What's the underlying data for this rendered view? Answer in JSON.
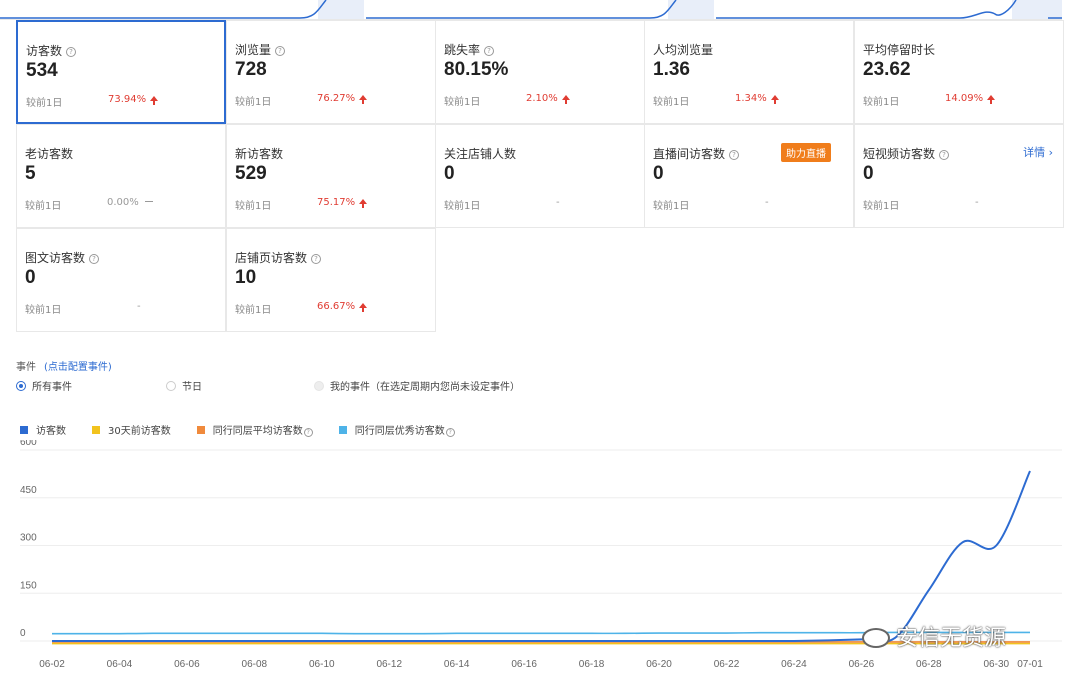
{
  "metrics": [
    {
      "label": "访客数",
      "help": true,
      "value": "534",
      "cmp": "较前1日",
      "pct": "73.94%",
      "trend": "up",
      "selected": true
    },
    {
      "label": "浏览量",
      "help": true,
      "value": "728",
      "cmp": "较前1日",
      "pct": "76.27%",
      "trend": "up"
    },
    {
      "label": "跳失率",
      "help": true,
      "value": "80.15%",
      "cmp": "较前1日",
      "pct": "2.10%",
      "trend": "up"
    },
    {
      "label": "人均浏览量",
      "help": false,
      "value": "1.36",
      "cmp": "较前1日",
      "pct": "1.34%",
      "trend": "up"
    },
    {
      "label": "平均停留时长",
      "help": false,
      "value": "23.62",
      "cmp": "较前1日",
      "pct": "14.09%",
      "trend": "up"
    },
    {
      "label": "老访客数",
      "help": false,
      "value": "5",
      "cmp": "较前1日",
      "pct": "0.00%",
      "trend": "flat"
    },
    {
      "label": "新访客数",
      "help": false,
      "value": "529",
      "cmp": "较前1日",
      "pct": "75.17%",
      "trend": "up"
    },
    {
      "label": "关注店铺人数",
      "help": false,
      "value": "0",
      "cmp": "较前1日",
      "pct": "-",
      "trend": "none"
    },
    {
      "label": "直播间访客数",
      "help": true,
      "value": "0",
      "cmp": "较前1日",
      "pct": "-",
      "trend": "none",
      "badge": "助力直播"
    },
    {
      "label": "短视频访客数",
      "help": true,
      "value": "0",
      "cmp": "较前1日",
      "pct": "-",
      "trend": "none",
      "detail": "详情 ›"
    },
    {
      "label": "图文访客数",
      "help": true,
      "value": "0",
      "cmp": "较前1日",
      "pct": "-",
      "trend": "none"
    },
    {
      "label": "店铺页访客数",
      "help": true,
      "value": "10",
      "cmp": "较前1日",
      "pct": "66.67%",
      "trend": "up"
    }
  ],
  "events": {
    "title": "事件",
    "config_link": "(点击配置事件)",
    "options": [
      "所有事件",
      "节日",
      "我的事件（在选定周期内您尚未设定事件）"
    ]
  },
  "watermark": "安信无货源",
  "colors": {
    "primary": "#2d6bd1",
    "up": "#e03c32",
    "badge": "#f07d1b"
  },
  "chart_data": {
    "type": "line",
    "x": [
      "06-02",
      "06-03",
      "06-04",
      "06-05",
      "06-06",
      "06-07",
      "06-08",
      "06-09",
      "06-10",
      "06-11",
      "06-12",
      "06-13",
      "06-14",
      "06-15",
      "06-16",
      "06-17",
      "06-18",
      "06-19",
      "06-20",
      "06-21",
      "06-22",
      "06-23",
      "06-24",
      "06-25",
      "06-26",
      "06-27",
      "06-28",
      "06-29",
      "06-30",
      "07-01"
    ],
    "tick_labels": [
      "06-02",
      "06-04",
      "06-06",
      "06-08",
      "06-10",
      "06-12",
      "06-14",
      "06-16",
      "06-18",
      "06-20",
      "06-22",
      "06-24",
      "06-26",
      "06-28",
      "06-30",
      "07-01"
    ],
    "y_ticks": [
      "600",
      "450",
      "300",
      "150",
      "0"
    ],
    "ylim": [
      0,
      600
    ],
    "grid": true,
    "legend_position": "top-left",
    "series": [
      {
        "name": "访客数",
        "color": "#2d6bd1",
        "values": [
          0,
          0,
          0,
          0,
          0,
          0,
          0,
          0,
          0,
          0,
          0,
          0,
          0,
          0,
          0,
          0,
          0,
          0,
          0,
          0,
          0,
          0,
          0,
          2,
          5,
          10,
          160,
          310,
          300,
          534
        ]
      },
      {
        "name": "30天前访客数",
        "color": "#f2c31d",
        "values": [
          -8,
          -8,
          -8,
          -8,
          -8,
          -8,
          -8,
          -8,
          -8,
          -8,
          -8,
          -8,
          -8,
          -8,
          -8,
          -8,
          -8,
          -8,
          -8,
          -8,
          -8,
          -8,
          -8,
          -8,
          -8,
          -8,
          -8,
          -8,
          -8,
          -8
        ]
      },
      {
        "name": "同行同层平均访客数",
        "help": true,
        "color": "#f08a3c",
        "values": [
          -3,
          -3,
          -3,
          -3,
          -3,
          -3,
          -3,
          -3,
          -3,
          -3,
          -3,
          -3,
          -3,
          -3,
          -3,
          -3,
          -3,
          -3,
          -3,
          -3,
          -3,
          -3,
          -3,
          -3,
          -3,
          -3,
          -3,
          -3,
          -3,
          -3
        ]
      },
      {
        "name": "同行同层优秀访客数",
        "help": true,
        "color": "#4eb3e8",
        "values": [
          23,
          23,
          23,
          24,
          24,
          24,
          24,
          24,
          24,
          23,
          23,
          23,
          24,
          24,
          24,
          24,
          24,
          24,
          25,
          25,
          25,
          26,
          26,
          26,
          26,
          27,
          27,
          27,
          27,
          27
        ]
      }
    ]
  }
}
